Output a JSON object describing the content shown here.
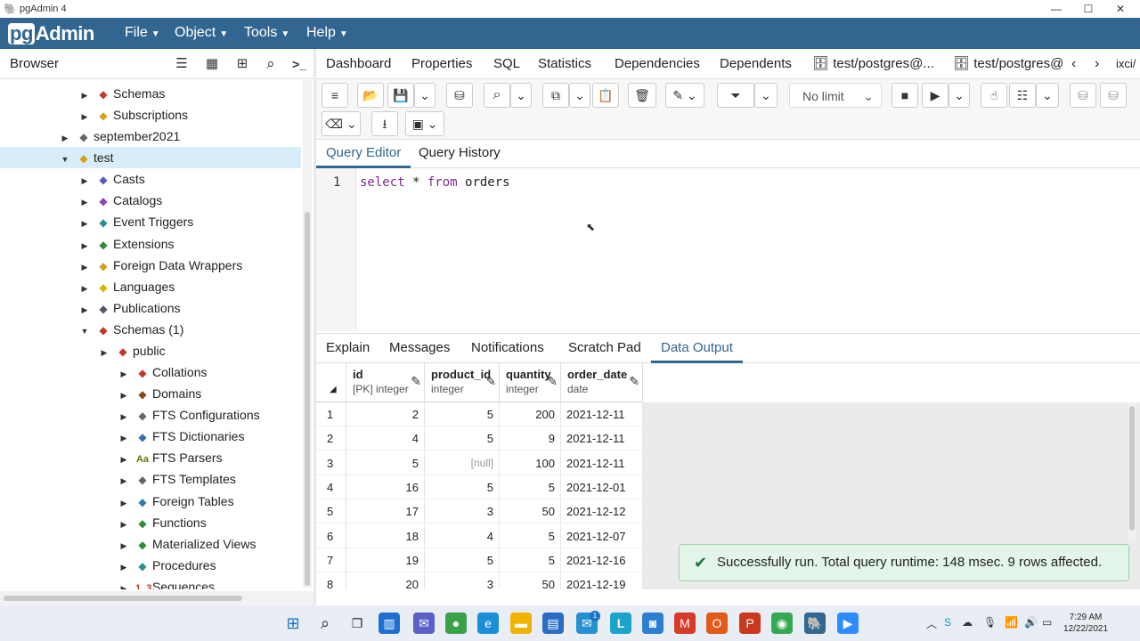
{
  "window": {
    "title": "pgAdmin 4",
    "minimize": "—",
    "maximize": "☐",
    "close": "✕"
  },
  "app": {
    "logo_pg": "pg",
    "logo_rest": "Admin"
  },
  "menu": [
    {
      "label": "File"
    },
    {
      "label": "Object"
    },
    {
      "label": "Tools"
    },
    {
      "label": "Help"
    }
  ],
  "browser": {
    "title": "Browser",
    "tree": [
      {
        "label": "Schemas",
        "icon": "schemas-icon",
        "color": "#c0392b"
      },
      {
        "label": "Subscriptions",
        "icon": "subscriptions-icon",
        "color": "#d4a017"
      },
      {
        "label": "september2021",
        "icon": "database-icon",
        "color": "#666"
      },
      {
        "label": "test",
        "icon": "database-icon",
        "color": "#d4a017"
      },
      {
        "label": "Casts",
        "icon": "casts-icon",
        "color": "#5b5bbf"
      },
      {
        "label": "Catalogs",
        "icon": "catalogs-icon",
        "color": "#8e44ad"
      },
      {
        "label": "Event Triggers",
        "icon": "event-triggers-icon",
        "color": "#2a8f8f"
      },
      {
        "label": "Extensions",
        "icon": "extensions-icon",
        "color": "#2e8b3a"
      },
      {
        "label": "Foreign Data Wrappers",
        "icon": "fdw-icon",
        "color": "#d4a017"
      },
      {
        "label": "Languages",
        "icon": "languages-icon",
        "color": "#d4b800"
      },
      {
        "label": "Publications",
        "icon": "publications-icon",
        "color": "#556"
      },
      {
        "label": "Schemas (1)",
        "icon": "schemas-icon",
        "color": "#c0392b"
      },
      {
        "label": "public",
        "icon": "schema-icon",
        "color": "#c0392b"
      },
      {
        "label": "Collations",
        "icon": "collations-icon",
        "color": "#c0392b"
      },
      {
        "label": "Domains",
        "icon": "domains-icon",
        "color": "#8b4513"
      },
      {
        "label": "FTS Configurations",
        "icon": "fts-configurations-icon",
        "color": "#666"
      },
      {
        "label": "FTS Dictionaries",
        "icon": "fts-dictionaries-icon",
        "color": "#3a6ea5"
      },
      {
        "label": "FTS Parsers",
        "icon": "fts-parsers-icon",
        "color": "#5a7d00",
        "glyph": "Aa"
      },
      {
        "label": "FTS Templates",
        "icon": "fts-templates-icon",
        "color": "#666"
      },
      {
        "label": "Foreign Tables",
        "icon": "foreign-tables-icon",
        "color": "#2a7fb0"
      },
      {
        "label": "Functions",
        "icon": "functions-icon",
        "color": "#2e8b3a"
      },
      {
        "label": "Materialized Views",
        "icon": "materialized-views-icon",
        "color": "#2e8b3a"
      },
      {
        "label": "Procedures",
        "icon": "procedures-icon",
        "color": "#2a8f8f"
      },
      {
        "label": "Sequences",
        "icon": "sequences-icon",
        "color": "#c0392b",
        "glyph": "1..3"
      }
    ]
  },
  "tabs": [
    {
      "label": "Dashboard"
    },
    {
      "label": "Properties"
    },
    {
      "label": "SQL"
    },
    {
      "label": "Statistics"
    },
    {
      "label": "Dependencies"
    },
    {
      "label": "Dependents"
    },
    {
      "label": "test/postgres@..."
    },
    {
      "label": "test/postgres@"
    },
    {
      "label": "ixci/"
    }
  ],
  "toolbar": {
    "limit": "No limit"
  },
  "query_tabs": [
    {
      "label": "Query Editor"
    },
    {
      "label": "Query History"
    }
  ],
  "editor": {
    "line_number": "1",
    "kw1": "select",
    "mid": " * ",
    "kw2": "from",
    "rest": " orders"
  },
  "output_tabs": [
    {
      "label": "Explain"
    },
    {
      "label": "Messages"
    },
    {
      "label": "Notifications"
    },
    {
      "label": "Scratch Pad"
    },
    {
      "label": "Data Output"
    }
  ],
  "grid": {
    "columns": [
      {
        "name": "id",
        "type": "[PK] integer"
      },
      {
        "name": "product_id",
        "type": "integer"
      },
      {
        "name": "quantity",
        "type": "integer"
      },
      {
        "name": "order_date",
        "type": "date"
      }
    ],
    "rows": [
      {
        "n": "1",
        "id": "2",
        "product_id": "5",
        "quantity": "200",
        "order_date": "2021-12-11"
      },
      {
        "n": "2",
        "id": "4",
        "product_id": "5",
        "quantity": "9",
        "order_date": "2021-12-11"
      },
      {
        "n": "3",
        "id": "5",
        "product_id": "[null]",
        "quantity": "100",
        "order_date": "2021-12-11"
      },
      {
        "n": "4",
        "id": "16",
        "product_id": "5",
        "quantity": "5",
        "order_date": "2021-12-01"
      },
      {
        "n": "5",
        "id": "17",
        "product_id": "3",
        "quantity": "50",
        "order_date": "2021-12-12"
      },
      {
        "n": "6",
        "id": "18",
        "product_id": "4",
        "quantity": "5",
        "order_date": "2021-12-07"
      },
      {
        "n": "7",
        "id": "19",
        "product_id": "5",
        "quantity": "5",
        "order_date": "2021-12-16"
      },
      {
        "n": "8",
        "id": "20",
        "product_id": "3",
        "quantity": "50",
        "order_date": "2021-12-19"
      }
    ]
  },
  "toast": {
    "message": "Successfully run. Total query runtime: 148 msec. 9 rows affected."
  },
  "taskbar": {
    "time": "7:29 AM",
    "date": "12/22/2021",
    "badge": "1"
  }
}
